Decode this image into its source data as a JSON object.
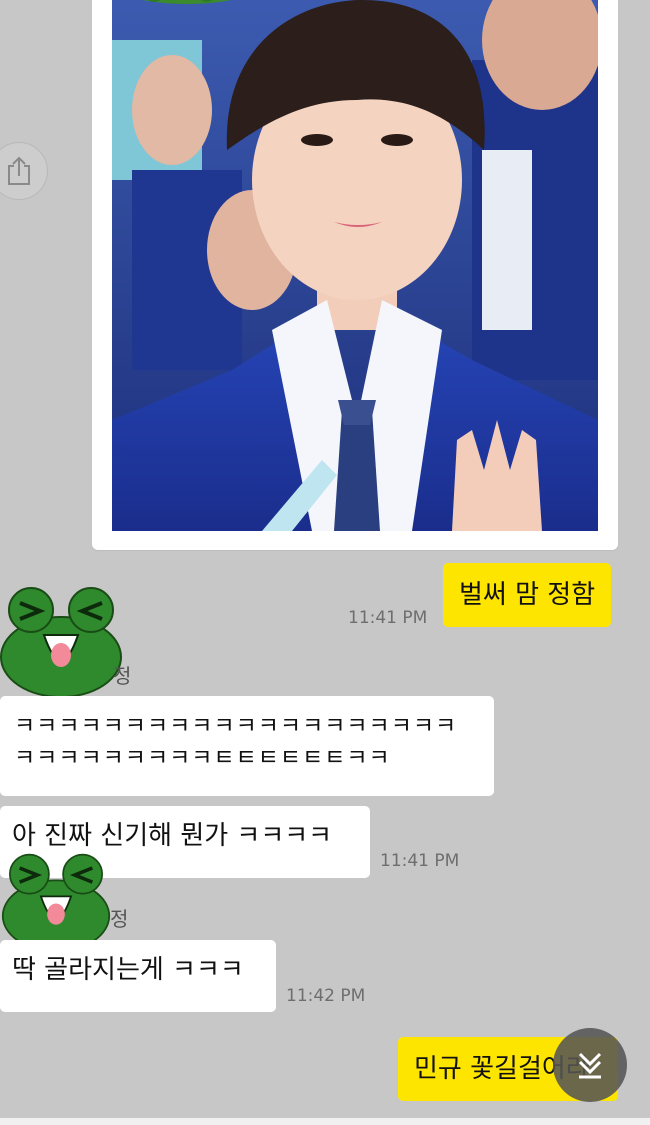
{
  "colors": {
    "background": "#c7c7c7",
    "my_bubble": "#fee500",
    "their_bubble": "#ffffff",
    "timestamp": "#6e6e6e"
  },
  "photo_message": {
    "image": "photo of a smiling young man in a navy school-style blazer and plaid tie, waving"
  },
  "share_button": {
    "icon": "share-icon"
  },
  "messages": {
    "m1": {
      "text": "벌써 맘 정함",
      "time": "11:41 PM"
    },
    "sender1": {
      "name": "정",
      "avatar": "frog-emoticon"
    },
    "m2": {
      "line1": "ㅋㅋㅋㅋㅋㅋㅋㅋㅋㅋㅋㅋㅋㅋㅋㅋㅋㅋㅋㅋ",
      "line2": "ㅋㅋㅋㅋㅋㅋㅋㅋㅋㅌㅌㅌㅌㅌㅌㅋㅋ"
    },
    "m3": {
      "text": "아 진짜 신기해 뭔가 ㅋㅋㅋㅋ",
      "time": "11:41 PM"
    },
    "sender2": {
      "name": "정",
      "avatar": "frog-emoticon"
    },
    "m4": {
      "text": "딱 골라지는게 ㅋㅋㅋ",
      "time": "11:42 PM"
    },
    "m5": {
      "text": "민규 꽃길걸어라"
    }
  },
  "scroll_down": {
    "icon": "chevron-double-down-icon"
  }
}
